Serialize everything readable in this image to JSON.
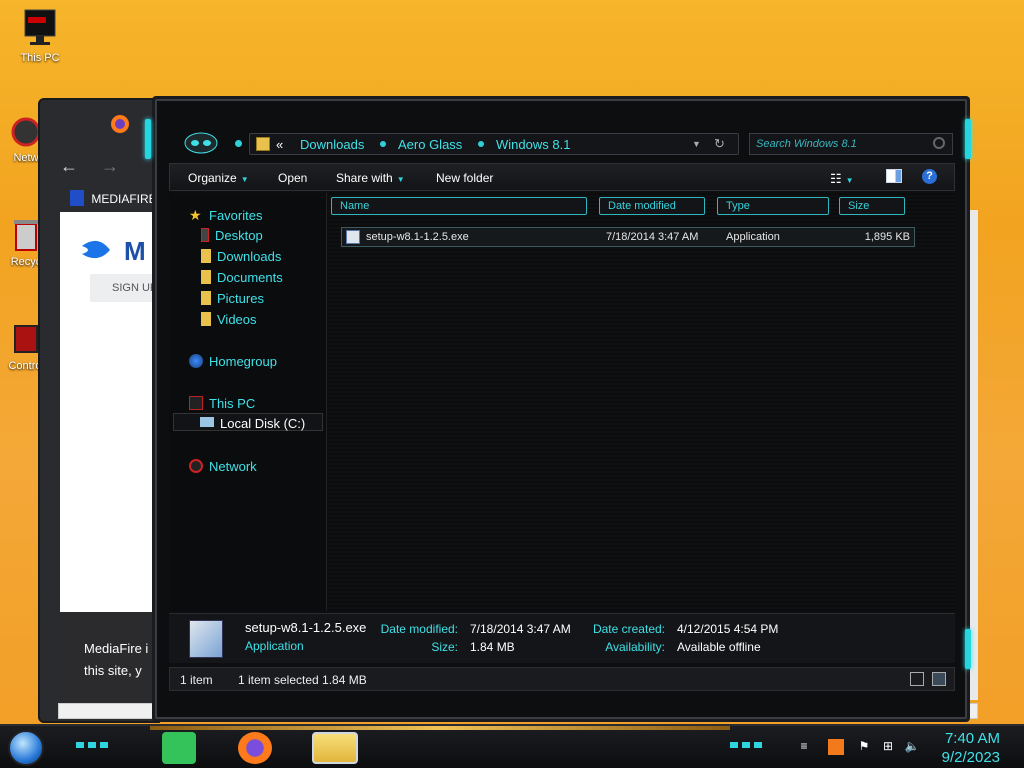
{
  "desktop": {
    "icons": [
      {
        "label": "This PC",
        "icon": "monitor-icon"
      },
      {
        "label": "Netw",
        "icon": "network-icon"
      },
      {
        "label": "Recyc",
        "icon": "recycle-bin-icon"
      },
      {
        "label": "Contro",
        "icon": "control-panel-icon"
      }
    ]
  },
  "browser": {
    "tab_icon": "firefox-icon",
    "back": "←",
    "forward": "→",
    "bookmark_label": "MEDIAFIRE",
    "logo_text": "M",
    "signup_label": "SIGN UP",
    "footer_line1": "MediaFire i",
    "footer_line2": "this site, y"
  },
  "explorer": {
    "breadcrumb": {
      "overflow": "«",
      "items": [
        "Downloads",
        "Aero Glass",
        "Windows 8.1"
      ]
    },
    "search_placeholder": "Search Windows 8.1",
    "toolbar": {
      "organize": "Organize",
      "open": "Open",
      "share_with": "Share with",
      "new_folder": "New folder"
    },
    "nav": {
      "favorites": "Favorites",
      "favorites_items": [
        "Desktop",
        "Downloads",
        "Documents",
        "Pictures",
        "Videos"
      ],
      "homegroup": "Homegroup",
      "this_pc": "This PC",
      "local_disk": "Local Disk (C:)",
      "network": "Network"
    },
    "columns": [
      "Name",
      "Date modified",
      "Type",
      "Size"
    ],
    "files": [
      {
        "name": "setup-w8.1-1.2.5.exe",
        "date_modified": "7/18/2014 3:47 AM",
        "type": "Application",
        "size": "1,895 KB"
      }
    ],
    "details": {
      "filename": "setup-w8.1-1.2.5.exe",
      "type": "Application",
      "date_modified_label": "Date modified:",
      "date_modified": "7/18/2014 3:47 AM",
      "size_label": "Size:",
      "size": "1.84 MB",
      "date_created_label": "Date created:",
      "date_created": "4/12/2015 4:54 PM",
      "availability_label": "Availability:",
      "availability": "Available offline"
    },
    "status": {
      "count": "1 item",
      "selected": "1 item selected  1.84 MB"
    }
  },
  "taskbar": {
    "time": "7:40 AM",
    "date": "9/2/2023",
    "apps": [
      "sticky-notes-icon",
      "firefox-icon",
      "file-explorer-icon"
    ]
  },
  "colors": {
    "accent": "#3fe1e8",
    "wallpaper": "#f4a838"
  }
}
